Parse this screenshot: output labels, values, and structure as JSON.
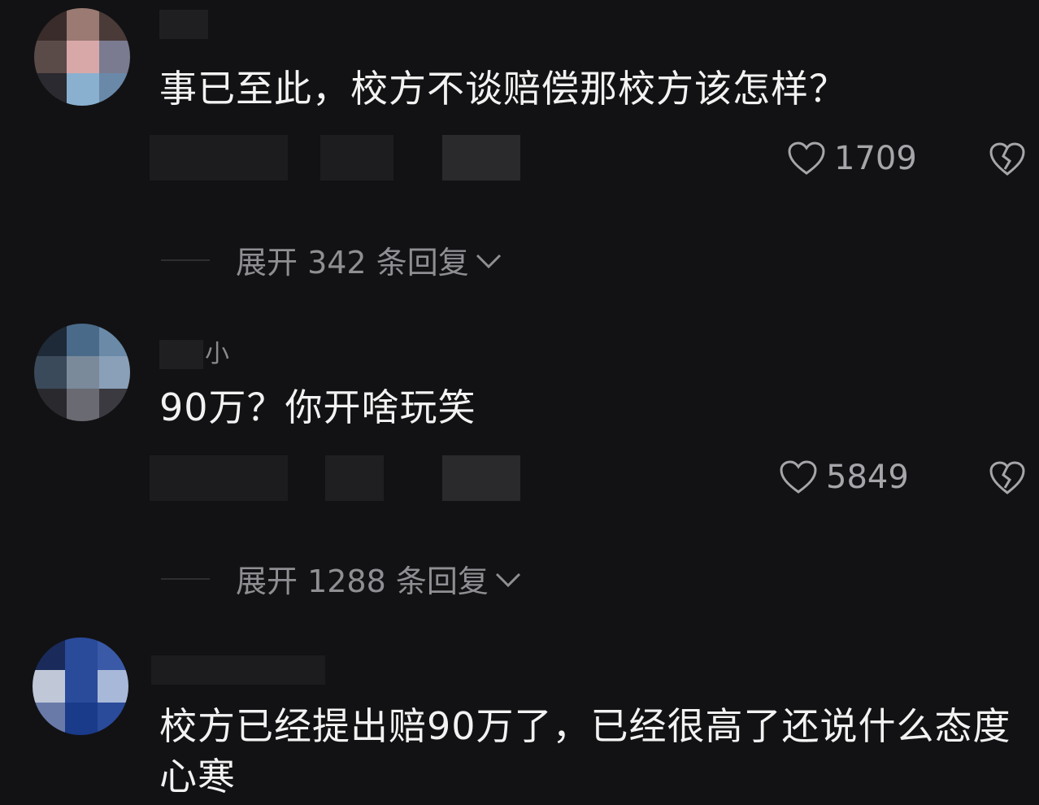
{
  "comments": [
    {
      "name_fragment": "",
      "text": "事已至此，校方不谈赔偿那校方该怎样？",
      "likes": "1709",
      "expand_label": "展开 342 条回复"
    },
    {
      "name_fragment": "小",
      "text": "90万？你开啥玩笑",
      "likes": "5849",
      "expand_label": "展开 1288 条回复"
    },
    {
      "name_fragment": "",
      "text": "校方已经提出赔90万了，已经很高了还说什么态度心寒",
      "likes": "",
      "expand_label": ""
    }
  ],
  "icons": {
    "like": "heart-outline-icon",
    "dislike": "broken-heart-icon",
    "expand": "chevron-down-icon"
  },
  "colors": {
    "background": "#121214",
    "text": "#f2f2f2",
    "secondary": "#a6a6aa"
  }
}
